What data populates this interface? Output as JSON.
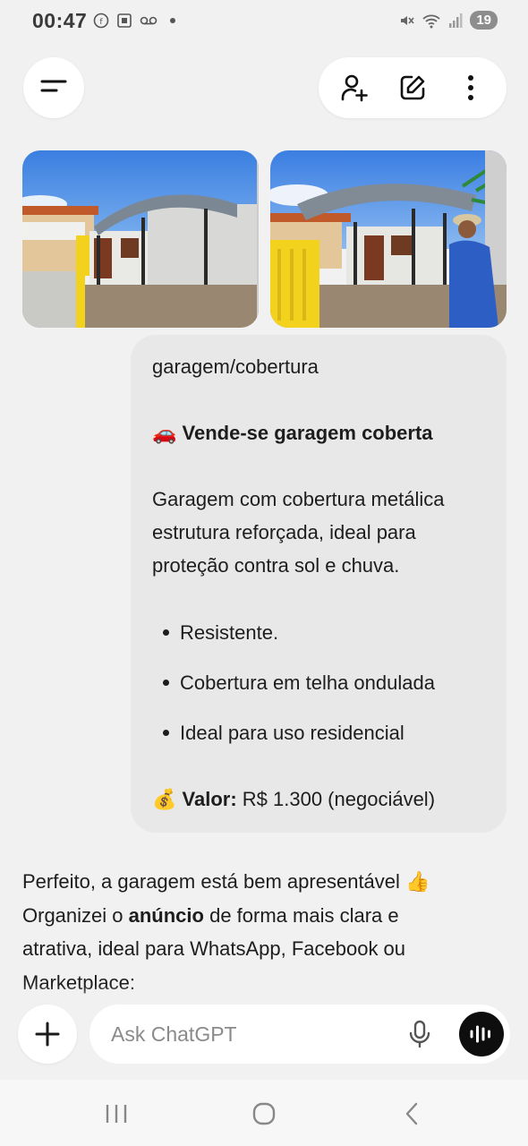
{
  "status_bar": {
    "time": "00:47",
    "battery": "19"
  },
  "icons": {
    "menu": "menu-icon",
    "add_person": "add-person-icon",
    "edit": "edit-icon",
    "more": "more-vert-icon",
    "plus": "plus-icon",
    "mic": "mic-icon",
    "voice": "voice-icon"
  },
  "user_message": {
    "images": [
      "garage photo 1",
      "garage photo 2"
    ],
    "line1": "garagem/cobertura",
    "emoji_car": "🚗",
    "headline": "Vende-se garagem coberta",
    "para1_line1": "Garagem com cobertura metálica",
    "para1_line2": "estrutura reforçada, ideal para",
    "para1_line3": "proteção contra sol e chuva.",
    "bullets": [
      "Resistente.",
      "Cobertura em telha ondulada",
      "Ideal para uso residencial"
    ],
    "emoji_money": "💰",
    "price_label": "Valor:",
    "price_value": " R$ 1.300 (negociável)"
  },
  "assistant_message": {
    "line1": "Perfeito, a garagem está bem apresentável ",
    "emoji_thumb": "👍",
    "line2_pre": "Organizei o ",
    "line2_bold": "anúncio",
    "line2_post": " de forma mais clara e",
    "line3": "atrativa, ideal para WhatsApp, Facebook ou",
    "line4": "Marketplace:"
  },
  "composer": {
    "placeholder": "Ask ChatGPT"
  }
}
